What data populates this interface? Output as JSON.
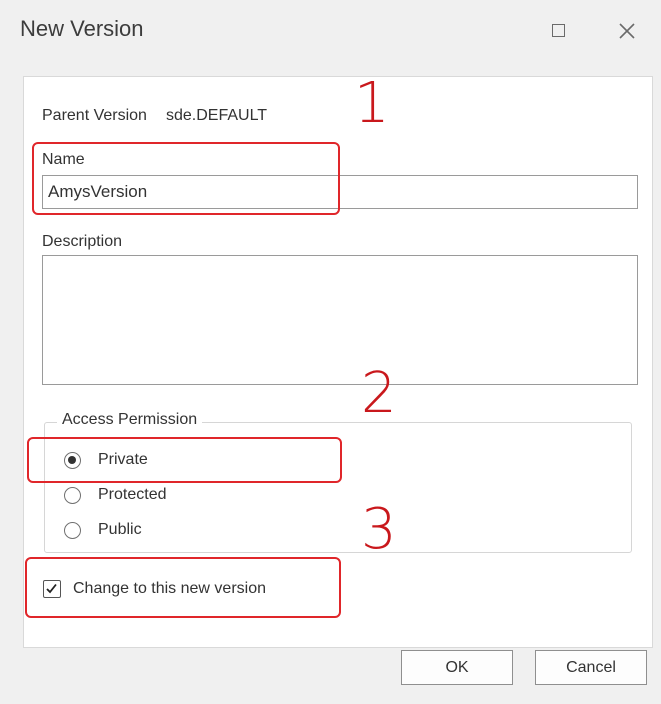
{
  "window": {
    "title": "New Version",
    "controls": {
      "maximize_icon": "maximize-icon",
      "close_icon": "close-icon"
    }
  },
  "form": {
    "parent_version_label": "Parent Version",
    "parent_version_value": "sde.DEFAULT",
    "name_label": "Name",
    "name_value": "AmysVersion",
    "description_label": "Description",
    "description_value": ""
  },
  "access_permission": {
    "legend": "Access Permission",
    "options": [
      {
        "label": "Private",
        "selected": true
      },
      {
        "label": "Protected",
        "selected": false
      },
      {
        "label": "Public",
        "selected": false
      }
    ]
  },
  "change_version": {
    "label": "Change to this new version",
    "checked": true
  },
  "annotations": {
    "one": "1",
    "two": "2",
    "three": "3",
    "color": "#e0262a"
  },
  "buttons": {
    "ok": "OK",
    "cancel": "Cancel"
  }
}
